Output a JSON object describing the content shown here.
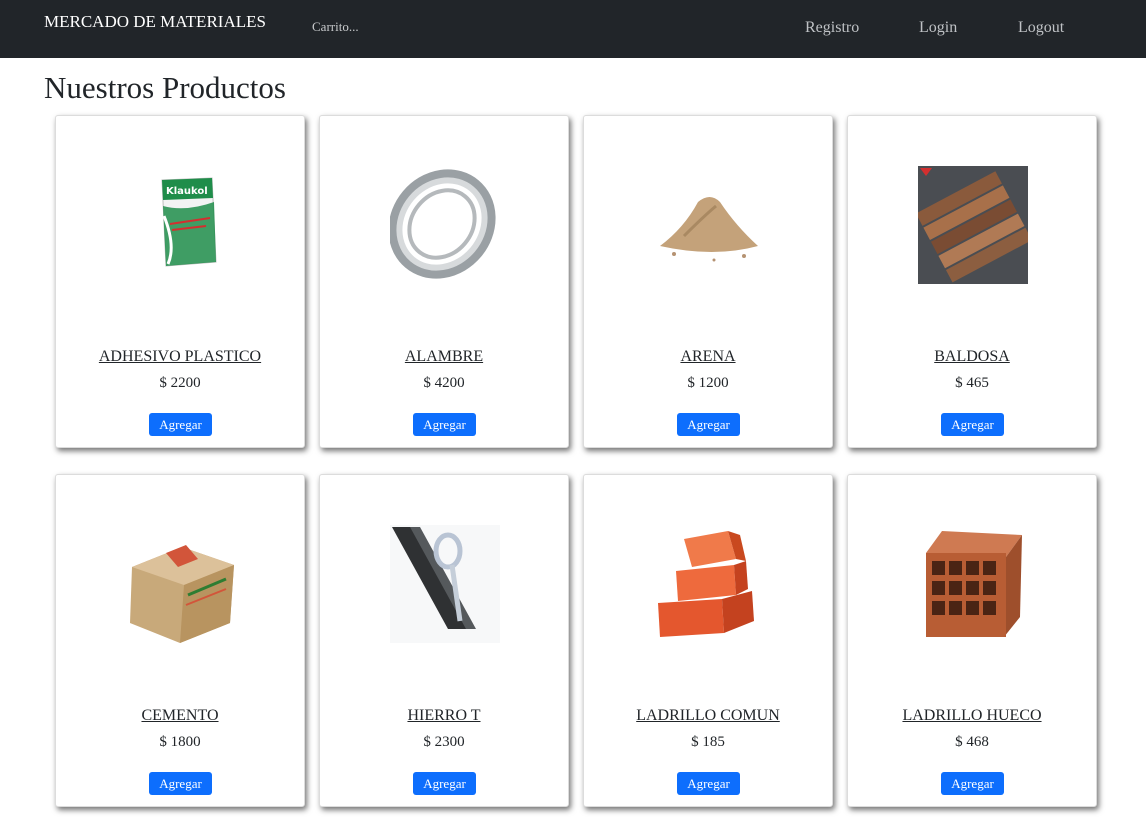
{
  "navbar": {
    "brand": "MERCADO DE MATERIALES",
    "cart": "Carrito...",
    "links": [
      "Registro",
      "Login",
      "Logout"
    ]
  },
  "page_title": "Nuestros Productos",
  "products": [
    {
      "name": "ADHESIVO PLASTICO",
      "price": "$ 2200",
      "button": "Agregar",
      "icon": "adhesive-bag-icon"
    },
    {
      "name": "ALAMBRE",
      "price": "$ 4200",
      "button": "Agregar",
      "icon": "wire-coil-icon"
    },
    {
      "name": "ARENA",
      "price": "$ 1200",
      "button": "Agregar",
      "icon": "sand-pile-icon"
    },
    {
      "name": "BALDOSA",
      "price": "$ 465",
      "button": "Agregar",
      "icon": "tile-icon"
    },
    {
      "name": "CEMENTO",
      "price": "$ 1800",
      "button": "Agregar",
      "icon": "cement-bag-icon"
    },
    {
      "name": "HIERRO T",
      "price": "$ 2300",
      "button": "Agregar",
      "icon": "iron-t-bar-icon"
    },
    {
      "name": "LADRILLO COMUN",
      "price": "$ 185",
      "button": "Agregar",
      "icon": "brick-stack-icon"
    },
    {
      "name": "LADRILLO HUECO",
      "price": "$ 468",
      "button": "Agregar",
      "icon": "hollow-brick-icon"
    }
  ],
  "colors": {
    "navbar_bg": "#212529",
    "button_bg": "#0d6efd",
    "button_text": "#ffffff"
  }
}
